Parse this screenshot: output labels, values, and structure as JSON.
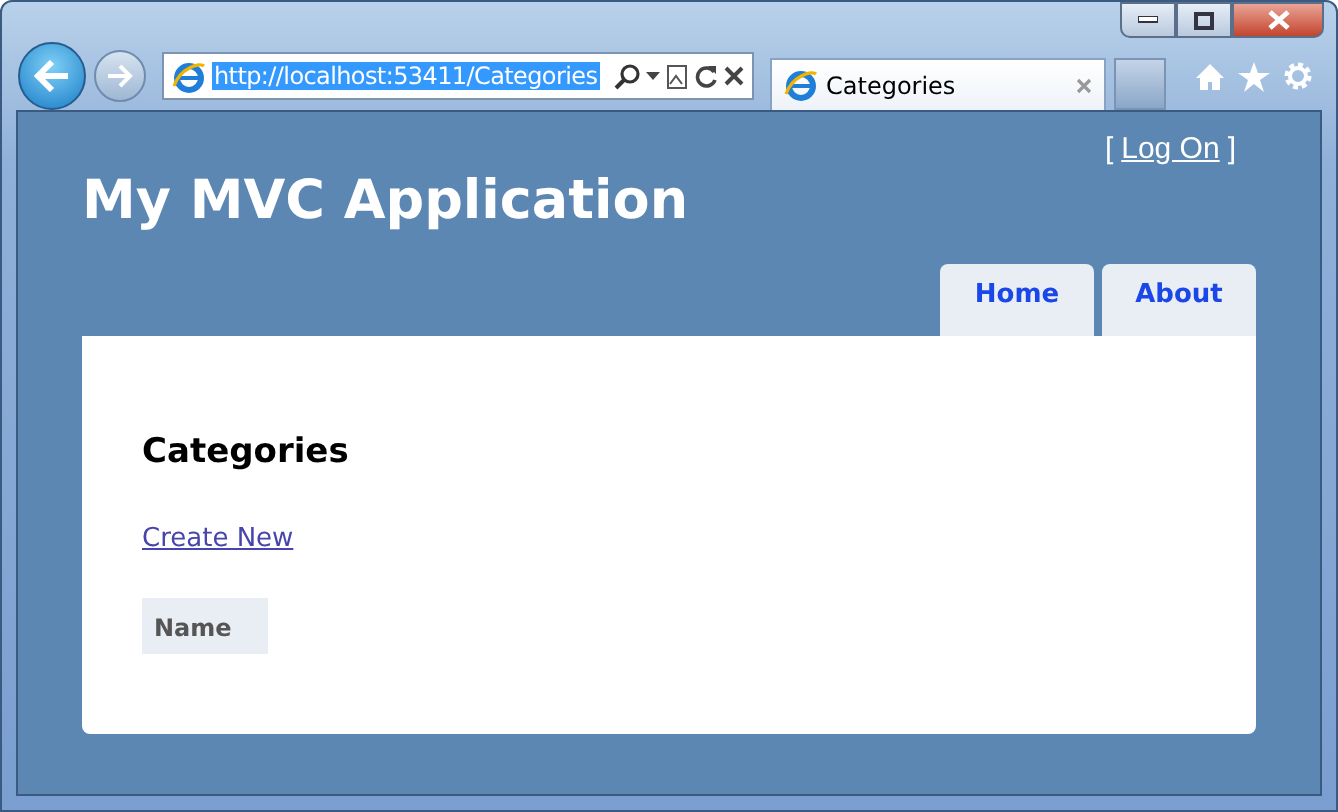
{
  "browser": {
    "address": "http://localhost:53411/Categories",
    "address_selected": true,
    "tab": {
      "title": "Categories"
    }
  },
  "page": {
    "login": {
      "open": "[",
      "link": "Log On",
      "close": "]"
    },
    "site_title": "My MVC Application",
    "menu": [
      {
        "label": "Home"
      },
      {
        "label": "About"
      }
    ],
    "heading": "Categories",
    "create_link": "Create New",
    "table": {
      "columns": [
        "Name"
      ]
    }
  }
}
